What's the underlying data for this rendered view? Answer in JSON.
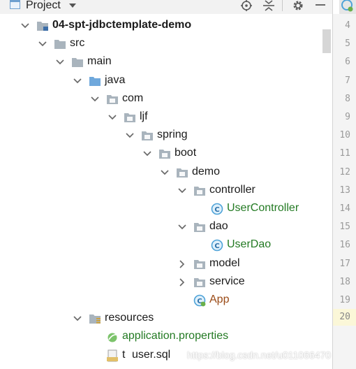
{
  "header": {
    "title": "Project",
    "icon": "project-window-icon",
    "tools": [
      "locate-icon",
      "collapse-all-icon",
      "gear-icon",
      "minimize-icon"
    ]
  },
  "tree": [
    {
      "label": "04-spt-jdbctemplate-demo",
      "type": "module",
      "expanded": true,
      "bold": true
    },
    {
      "label": "src",
      "type": "folder",
      "expanded": true
    },
    {
      "label": "main",
      "type": "folder",
      "expanded": true
    },
    {
      "label": "java",
      "type": "source-folder",
      "expanded": true
    },
    {
      "label": "com",
      "type": "package",
      "expanded": true
    },
    {
      "label": "ljf",
      "type": "package",
      "expanded": true
    },
    {
      "label": "spring",
      "type": "package",
      "expanded": true
    },
    {
      "label": "boot",
      "type": "package",
      "expanded": true
    },
    {
      "label": "demo",
      "type": "package",
      "expanded": true
    },
    {
      "label": "controller",
      "type": "package",
      "expanded": true
    },
    {
      "label": "UserController",
      "type": "class"
    },
    {
      "label": "dao",
      "type": "package",
      "expanded": true
    },
    {
      "label": "UserDao",
      "type": "class"
    },
    {
      "label": "model",
      "type": "package",
      "expanded": false
    },
    {
      "label": "service",
      "type": "package",
      "expanded": false
    },
    {
      "label": "App",
      "type": "spring-boot-class"
    },
    {
      "label": "resources",
      "type": "resources-folder",
      "expanded": true
    },
    {
      "label": "application.properties",
      "type": "properties-file"
    },
    {
      "label": "user.sql",
      "type": "sql-file",
      "prefix": "t"
    }
  ],
  "gutter": {
    "line_numbers": [
      "4",
      "5",
      "6",
      "7",
      "8",
      "9",
      "10",
      "11",
      "12",
      "13",
      "14",
      "15",
      "16",
      "17",
      "18",
      "19",
      "20"
    ],
    "current_line": "20"
  },
  "watermark": "https://blog.csdn.net/u011066470",
  "colors": {
    "java_class": "#237a23",
    "app_class": "#9a4a16",
    "folder": "#a9b4bd",
    "source_folder": "#6fa8dc",
    "class_icon": "#4ea3d8"
  }
}
